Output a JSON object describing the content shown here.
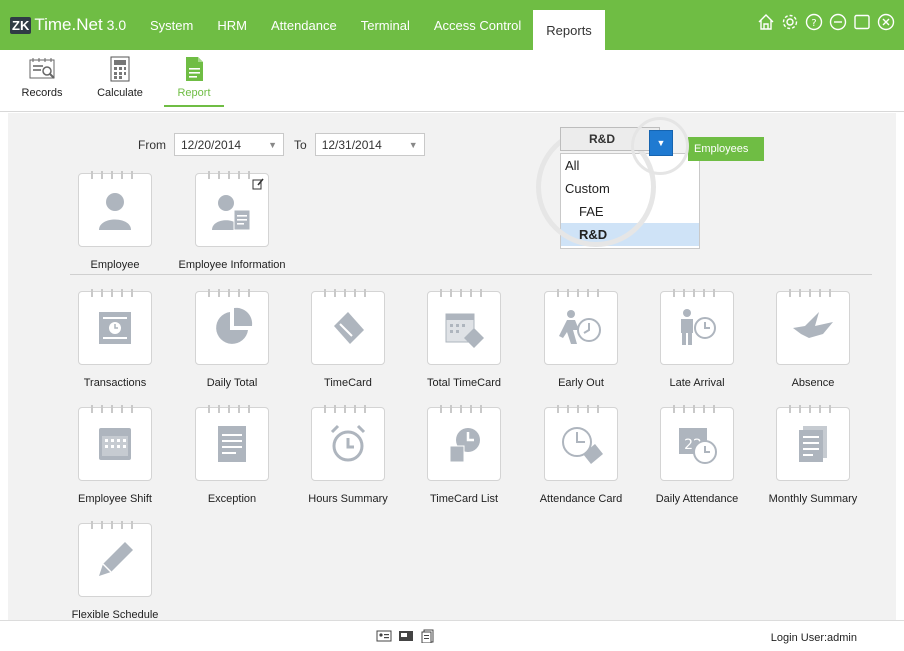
{
  "app": {
    "logo_badge": "ZK",
    "logo_name": "Time.Net",
    "logo_version": "3.0"
  },
  "menu": [
    {
      "label": "System"
    },
    {
      "label": "HRM"
    },
    {
      "label": "Attendance"
    },
    {
      "label": "Terminal"
    },
    {
      "label": "Access Control"
    },
    {
      "label": "Reports"
    }
  ],
  "top_icons": [
    "home-icon",
    "settings-icon",
    "help-icon",
    "minimize-icon",
    "maximize-icon",
    "close-icon"
  ],
  "toolbar": {
    "records": "Records",
    "calculate": "Calculate",
    "report": "Report"
  },
  "filters": {
    "from_label": "From",
    "from_value": "12/20/2014",
    "to_label": "To",
    "to_value": "12/31/2014"
  },
  "department": {
    "selected": "R&D",
    "employees_label": "Employees",
    "options": [
      "All",
      "Custom",
      "FAE",
      "R&D"
    ]
  },
  "reports_top": [
    {
      "label": "Employee",
      "icon": "employee-icon"
    },
    {
      "label": "Employee Information",
      "icon": "employee-info-icon"
    }
  ],
  "reports_row1": [
    {
      "label": "Transactions",
      "icon": "transactions-icon"
    },
    {
      "label": "Daily Total",
      "icon": "pie-chart-icon"
    },
    {
      "label": "TimeCard",
      "icon": "timecard-icon"
    },
    {
      "label": "Total TimeCard",
      "icon": "calendar-card-icon"
    },
    {
      "label": "Early Out",
      "icon": "running-clock-icon"
    },
    {
      "label": "Late Arrival",
      "icon": "person-clock-icon"
    },
    {
      "label": "Absence",
      "icon": "bird-icon"
    }
  ],
  "reports_row2": [
    {
      "label": "Employee Shift",
      "icon": "shift-calendar-icon"
    },
    {
      "label": "Exception",
      "icon": "document-icon"
    },
    {
      "label": "Hours Summary",
      "icon": "alarm-clock-icon"
    },
    {
      "label": "TimeCard List",
      "icon": "clock-doc-icon"
    },
    {
      "label": "Attendance Card",
      "icon": "clock-card-icon"
    },
    {
      "label": "Daily Attendance",
      "icon": "calendar-clock-icon"
    },
    {
      "label": "Monthly Summary",
      "icon": "stacked-docs-icon"
    }
  ],
  "reports_row3": [
    {
      "label": "Flexible Schedule",
      "icon": "pencil-icon"
    }
  ],
  "status": {
    "login_user": "Login User:admin"
  }
}
